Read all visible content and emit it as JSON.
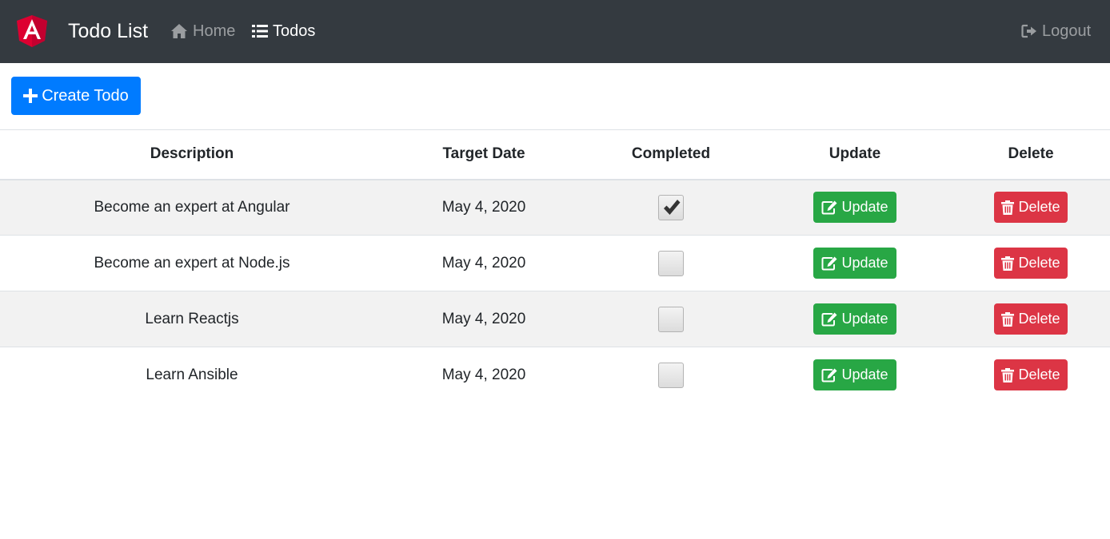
{
  "navbar": {
    "brand": "Todo List",
    "home": "Home",
    "todos": "Todos",
    "logout": "Logout",
    "logo_icon": "angular-logo-icon",
    "background": "#343a40"
  },
  "toolbar": {
    "create_label": "Create Todo"
  },
  "table": {
    "columns": [
      "Description",
      "Target Date",
      "Completed",
      "Update",
      "Delete"
    ],
    "rows": [
      {
        "description": "Become an expert at Angular",
        "target_date": "May 4, 2020",
        "completed": true,
        "update": "Update",
        "delete": "Delete"
      },
      {
        "description": "Become an expert at Node.js",
        "target_date": "May 4, 2020",
        "completed": false,
        "update": "Update",
        "delete": "Delete"
      },
      {
        "description": "Learn Reactjs",
        "target_date": "May 4, 2020",
        "completed": false,
        "update": "Update",
        "delete": "Delete"
      },
      {
        "description": "Learn Ansible",
        "target_date": "May 4, 2020",
        "completed": false,
        "update": "Update",
        "delete": "Delete"
      }
    ]
  },
  "colors": {
    "primary": "#007bff",
    "success": "#28a745",
    "danger": "#dc3545"
  }
}
